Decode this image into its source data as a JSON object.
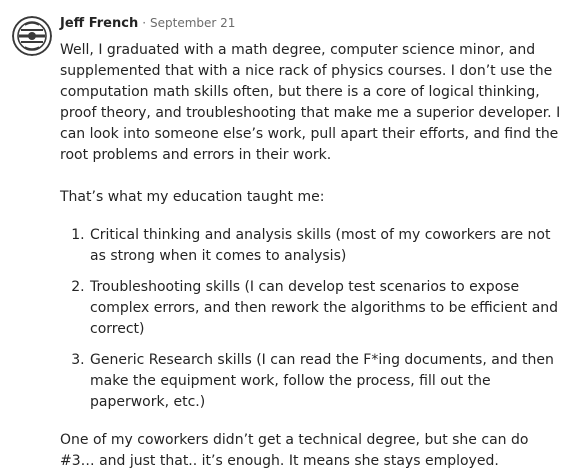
{
  "comment": {
    "author": "Jeff French",
    "separator": "·",
    "date": "September 21",
    "avatar_icon": "avatar-logo-icon",
    "paragraphs": [
      "Well, I graduated with a math degree, computer science minor, and supplemented that with a nice rack of physics courses. I don’t use the computation math skills often, but there is a core of logical thinking, proof theory, and troubleshooting that make me a superior developer. I can look into someone else’s work, pull apart their efforts, and find the root problems and errors in their work.",
      "That’s what my education taught me:"
    ],
    "list_items": [
      "Critical thinking and analysis skills (most of my coworkers are not as strong when it comes to analysis)",
      "Troubleshooting skills (I can develop test scenarios to expose complex errors, and then rework the algorithms to be efficient and correct)",
      "Generic Research skills (I can read the F*ing documents, and then make the equipment work, follow the process, fill out the paperwork, etc.)"
    ],
    "closing": "One of my coworkers didn’t get a technical degree, but she can do #3… and just that.. it’s enough. It means she stays employed."
  }
}
